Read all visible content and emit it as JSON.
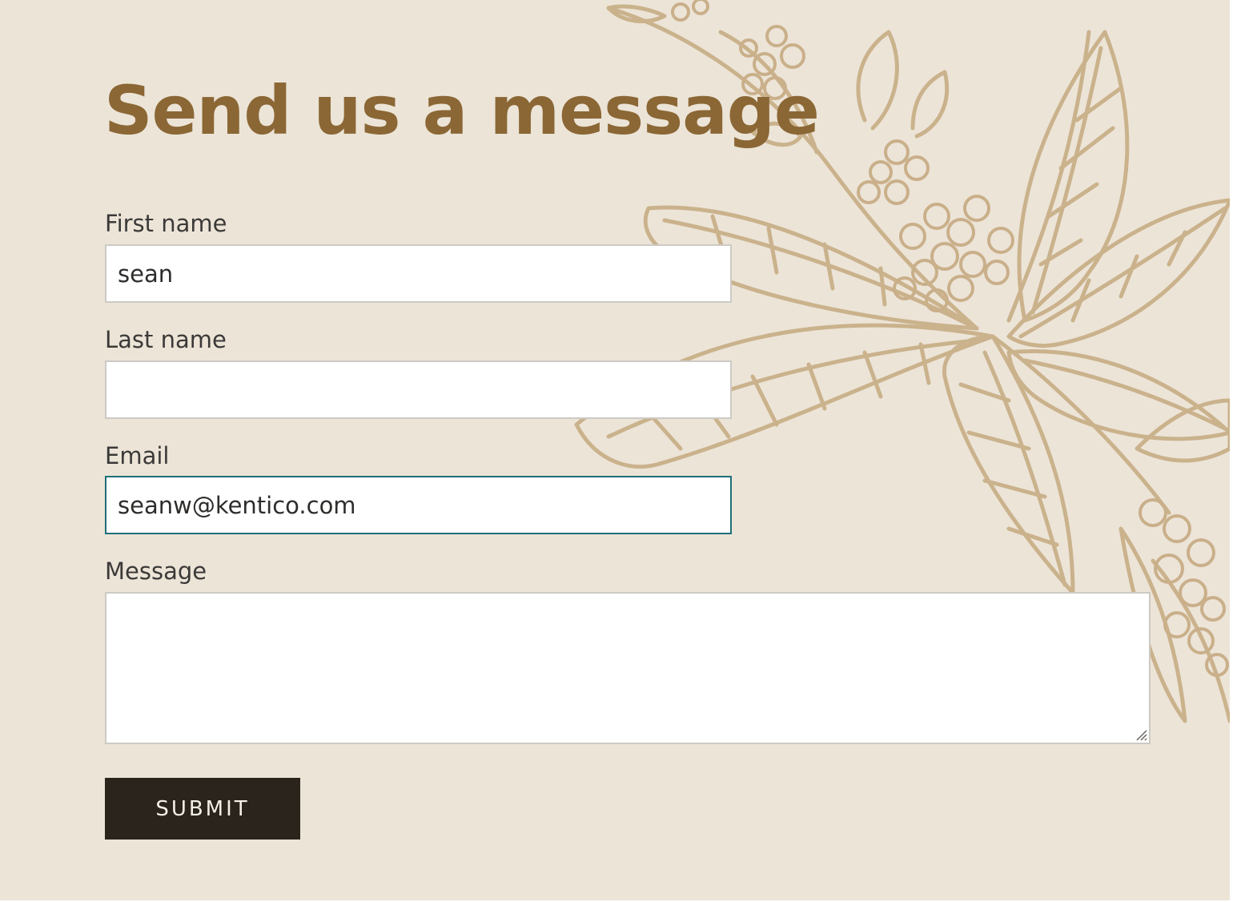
{
  "form": {
    "title": "Send us a message",
    "fields": {
      "first_name": {
        "label": "First name",
        "value": "sean"
      },
      "last_name": {
        "label": "Last name",
        "value": ""
      },
      "email": {
        "label": "Email",
        "value": "seanw@kentico.com"
      },
      "message": {
        "label": "Message",
        "value": ""
      }
    },
    "submit_label": "SUBMIT"
  },
  "colors": {
    "background": "#ede4d8",
    "heading": "#8a6735",
    "illustration": "#c9b08a",
    "focus_border": "#1e6f78",
    "button": "#2b241c",
    "button_text": "#f4efe7"
  },
  "icons": {
    "illustration": "coffee-plant-illustration",
    "resize": "resize-grip-icon"
  }
}
